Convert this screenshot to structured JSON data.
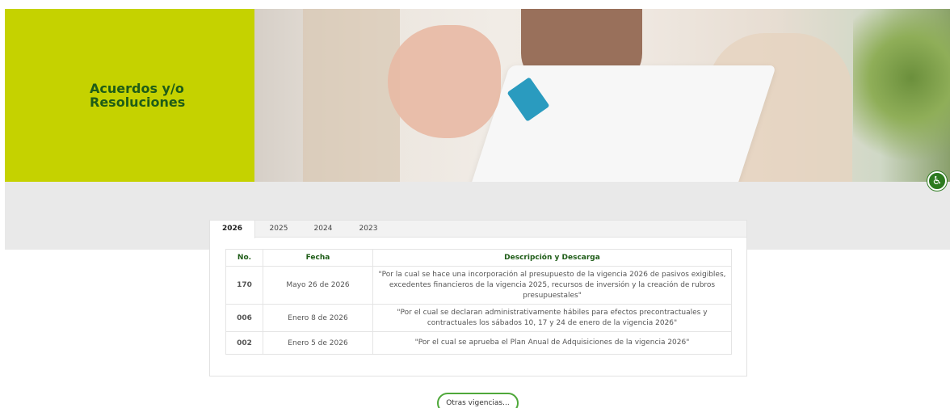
{
  "hero": {
    "title": "Acuerdos y/o\nResoluciones"
  },
  "accessibility": {
    "icon": "accessibility-icon",
    "glyph": "♿"
  },
  "tabs": [
    {
      "label": "2026",
      "active": true
    },
    {
      "label": "2025",
      "active": false
    },
    {
      "label": "2024",
      "active": false
    },
    {
      "label": "2023",
      "active": false
    }
  ],
  "table": {
    "headers": [
      "No.",
      "Fecha",
      "Descripción y Descarga"
    ],
    "rows": [
      {
        "no": "170",
        "fecha": "Mayo 26 de 2026",
        "desc": "\"Por la cual se hace una incorporación al presupuesto de la vigencia 2026 de pasivos exigibles, excedentes financieros de la vigencia 2025, recursos de inversión y la creación de rubros presupuestales\""
      },
      {
        "no": "006",
        "fecha": "Enero 8 de 2026",
        "desc": "\"Por el cual se declaran administrativamente hábiles para efectos precontractuales y contractuales los sábados 10, 17 y 24 de enero de la vigencia 2026\""
      },
      {
        "no": "002",
        "fecha": "Enero 5 de 2026",
        "desc": "\"Por el cual se aprueba el Plan Anual de Adquisiciones de la vigencia 2026\""
      }
    ]
  },
  "more_button": {
    "label": "Otras vigencias..."
  },
  "colors": {
    "brand_lime": "#c5d200",
    "brand_green": "#1e5c17",
    "link_green": "#8ec96a",
    "button_border": "#4fa83a"
  }
}
